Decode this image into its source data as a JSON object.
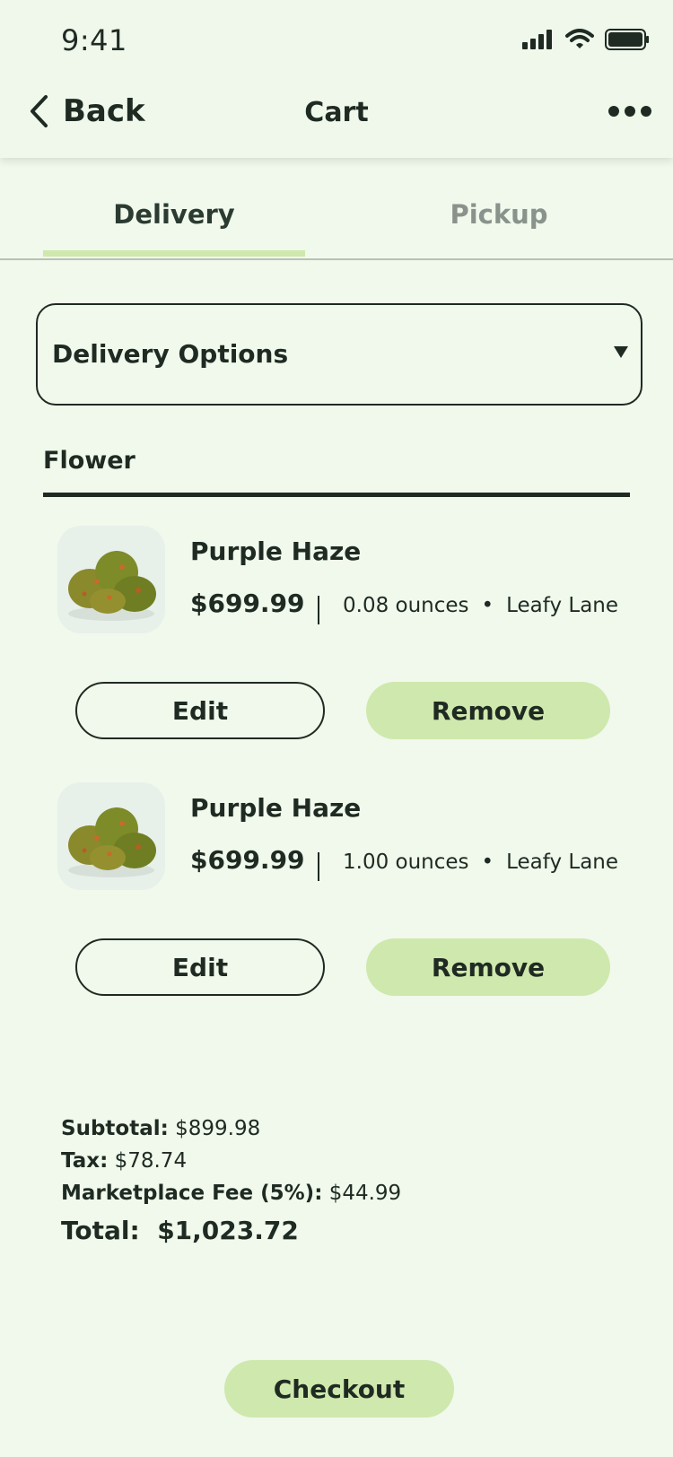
{
  "status_bar": {
    "time": "9:41"
  },
  "header": {
    "back_label": "Back",
    "title": "Cart"
  },
  "tabs": [
    {
      "label": "Delivery",
      "active": true
    },
    {
      "label": "Pickup",
      "active": false
    }
  ],
  "delivery_select": {
    "label": "Delivery Options"
  },
  "section": {
    "title": "Flower"
  },
  "items": [
    {
      "name": "Purple Haze",
      "price": "$699.99",
      "quantity": "0.08 ounces",
      "store": "Leafy Lane",
      "edit_label": "Edit",
      "remove_label": "Remove"
    },
    {
      "name": "Purple Haze",
      "price": "$699.99",
      "quantity": "1.00 ounces",
      "store": "Leafy Lane",
      "edit_label": "Edit",
      "remove_label": "Remove"
    }
  ],
  "summary": {
    "subtotal_label": "Subtotal:",
    "subtotal_value": "$899.98",
    "tax_label": "Tax:",
    "tax_value": "$78.74",
    "fee_label": "Marketplace Fee (5%):",
    "fee_value": "$44.99",
    "total_label": "Total:",
    "total_value": "$1,023.72"
  },
  "checkout_label": "Checkout",
  "colors": {
    "background": "#f0f9ec",
    "accent": "#cfe8ad",
    "text": "#1f2a22",
    "inactive_tab": "#8a938b"
  }
}
